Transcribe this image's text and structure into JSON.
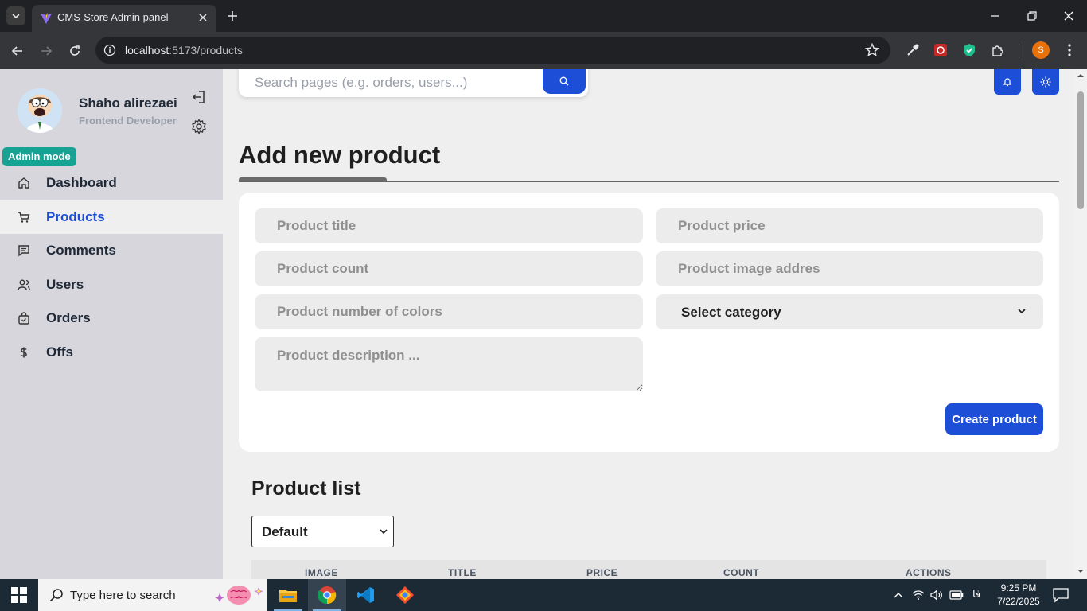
{
  "browser": {
    "tab_title": "CMS-Store Admin panel",
    "url_host": "localhost",
    "url_path": ":5173/products",
    "profile_initial": "S"
  },
  "sidebar": {
    "user_name": "Shaho alirezaei",
    "user_role": "Frontend Developer",
    "admin_badge": "Admin mode",
    "items": [
      {
        "label": "Dashboard",
        "icon": "home-icon"
      },
      {
        "label": "Products",
        "icon": "cart-icon",
        "active": true
      },
      {
        "label": "Comments",
        "icon": "comment-icon"
      },
      {
        "label": "Users",
        "icon": "users-icon"
      },
      {
        "label": "Orders",
        "icon": "bag-icon"
      },
      {
        "label": "Offs",
        "icon": "dollar-icon"
      }
    ]
  },
  "header": {
    "search_placeholder": "Search pages (e.g. orders, users...)"
  },
  "main": {
    "title": "Add new product",
    "form": {
      "title_placeholder": "Product title",
      "price_placeholder": "Product price",
      "count_placeholder": "Product count",
      "image_placeholder": "Product image addres",
      "colors_placeholder": "Product number of colors",
      "category_selected": "Select category",
      "description_placeholder": "Product description ...",
      "submit_label": "Create product"
    },
    "list": {
      "title": "Product list",
      "sort_selected": "Default",
      "columns": [
        "IMAGE",
        "TITLE",
        "PRICE",
        "COUNT",
        "ACTIONS"
      ]
    }
  },
  "taskbar": {
    "search_text": "Type here to search",
    "lang": "فا",
    "time": "9:25 PM",
    "date": "7/22/2025"
  },
  "colors": {
    "accent": "#1d4ed8",
    "badge": "#16a394",
    "sidebar_bg": "#d6d6dc",
    "page_bg": "#efefef"
  }
}
